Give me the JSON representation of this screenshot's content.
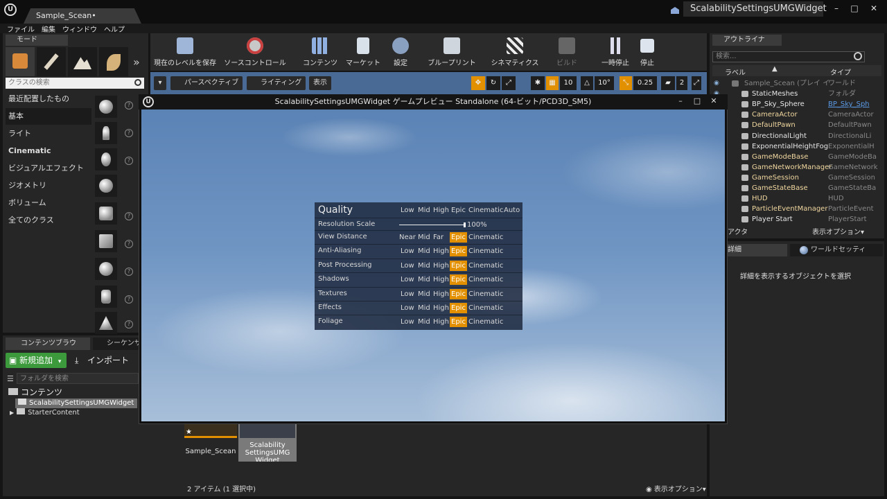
{
  "window": {
    "doc_tab": "Sample_Scean•",
    "project_name": "ScalabilitySettingsUMGWidget",
    "minimize": "–",
    "maximize": "□",
    "close": "✕"
  },
  "menu": [
    "ファイル",
    "編集",
    "ウィンドウ",
    "ヘルプ"
  ],
  "modes": {
    "tab_label": "モード",
    "search_placeholder": "クラスの検索",
    "categories": [
      "最近配置したもの",
      "基本",
      "ライト",
      "Cinematic",
      "ビジュアルエフェクト",
      "ジオメトリ",
      "ボリューム",
      "全てのクラス"
    ],
    "selected_category": "基本"
  },
  "toolbar": {
    "buttons": [
      {
        "label": "現在のレベルを保存",
        "icon": "save-icon"
      },
      {
        "label": "ソースコントロール",
        "icon": "source-control-icon"
      },
      {
        "label": "コンテンツ",
        "icon": "content-icon"
      },
      {
        "label": "マーケット",
        "icon": "marketplace-icon"
      },
      {
        "label": "設定",
        "icon": "settings-icon"
      },
      {
        "label": "ブループリント",
        "icon": "blueprint-icon"
      },
      {
        "label": "シネマティクス",
        "icon": "cinematics-icon"
      },
      {
        "label": "ビルド",
        "icon": "build-icon"
      },
      {
        "label": "一時停止",
        "icon": "pause-icon"
      },
      {
        "label": "停止",
        "icon": "stop-icon"
      }
    ]
  },
  "viewport": {
    "perspective": "パースペクティブ",
    "lighting": "ライティング",
    "show": "表示",
    "grid_snap": "10",
    "rotate_snap": "10°",
    "scale_snap": "0.25",
    "camera_speed": "2"
  },
  "preview": {
    "title": "ScalabilitySettingsUMGWidget ゲームプレビュー Standalone (64-ビット/PCD3D_SM5)",
    "quality": {
      "header": "Quality",
      "header_options": [
        "Low",
        "Mid",
        "High",
        "Epic",
        "Cinematic",
        "Auto"
      ],
      "resolution_label": "Resolution Scale",
      "resolution_value": "100%",
      "resolution_fraction": 1.0,
      "rows": [
        {
          "label": "View Distance",
          "options": [
            "Near",
            "Mid",
            "Far",
            "Epic",
            "Cinematic"
          ],
          "selected": "Epic"
        },
        {
          "label": "Anti-Aliasing",
          "options": [
            "Low",
            "Mid",
            "High",
            "Epic",
            "Cinematic"
          ],
          "selected": "Epic"
        },
        {
          "label": "Post Processing",
          "options": [
            "Low",
            "Mid",
            "High",
            "Epic",
            "Cinematic"
          ],
          "selected": "Epic"
        },
        {
          "label": "Shadows",
          "options": [
            "Low",
            "Mid",
            "High",
            "Epic",
            "Cinematic"
          ],
          "selected": "Epic"
        },
        {
          "label": "Textures",
          "options": [
            "Low",
            "Mid",
            "High",
            "Epic",
            "Cinematic"
          ],
          "selected": "Epic"
        },
        {
          "label": "Effects",
          "options": [
            "Low",
            "Mid",
            "High",
            "Epic",
            "Cinematic"
          ],
          "selected": "Epic"
        },
        {
          "label": "Foliage",
          "options": [
            "Low",
            "Mid",
            "High",
            "Epic",
            "Cinematic"
          ],
          "selected": "Epic"
        }
      ]
    }
  },
  "outliner": {
    "tab_label": "アウトライナ",
    "search_placeholder": "検索...",
    "col_label": "ラベル",
    "col_type": "タイプ",
    "rows": [
      {
        "name": "Sample_Scean (プレイ イ",
        "type": "ワールド",
        "dim": true
      },
      {
        "name": "StaticMeshes",
        "type": "フォルダ",
        "dim": false
      },
      {
        "name": "BP_Sky_Sphere",
        "type": "BP_Sky_Sph",
        "dim": false,
        "link": true
      },
      {
        "name": "CameraActor",
        "type": "CameraActor",
        "dim": false
      },
      {
        "name": "DefaultPawn",
        "type": "DefaultPawn",
        "dim": false
      },
      {
        "name": "DirectionalLight",
        "type": "DirectionalLi",
        "dim": false
      },
      {
        "name": "ExponentialHeightFog",
        "type": "ExponentialH",
        "dim": false
      },
      {
        "name": "GameModeBase",
        "type": "GameModeBa",
        "dim": false
      },
      {
        "name": "GameNetworkManager",
        "type": "GameNetwork",
        "dim": false
      },
      {
        "name": "GameSession",
        "type": "GameSession",
        "dim": false
      },
      {
        "name": "GameStateBase",
        "type": "GameStateBa",
        "dim": false
      },
      {
        "name": "HUD",
        "type": "HUD",
        "dim": false
      },
      {
        "name": "ParticleEventManager",
        "type": "ParticleEvent",
        "dim": false
      },
      {
        "name": "Player Start",
        "type": "PlayerStart",
        "dim": false
      }
    ],
    "footer_left": "アクタ",
    "footer_right": "表示オプション▾"
  },
  "details": {
    "tab_label": "詳細",
    "world_tab": "ワールドセッティ",
    "message": "詳細を表示するオブジェクトを選択"
  },
  "content_browser": {
    "tab_label": "コンテンツブラウ",
    "seq_tab": "シーケンサ",
    "add_new": "新規追加",
    "import": "インポート",
    "folder_search_placeholder": "フォルダを検索",
    "tree": [
      {
        "label": "コンテンツ",
        "level": 0
      },
      {
        "label": "ScalabilitySettingsUMGWidget",
        "level": 1,
        "selected": true
      },
      {
        "label": "StarterContent",
        "level": 1
      }
    ],
    "assets": [
      {
        "label": "Sample_Scean"
      },
      {
        "label": "Scalability SettingsUMG Widget"
      }
    ],
    "status": "2 アイテム (1 選択中)",
    "view_options": "表示オプション▾"
  }
}
